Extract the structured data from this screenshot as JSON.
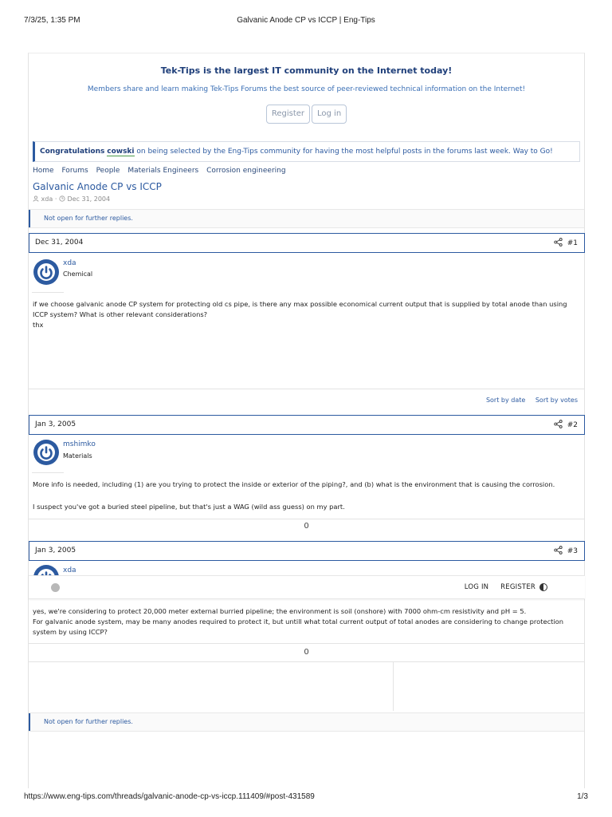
{
  "print": {
    "datetime": "7/3/25, 1:35 PM",
    "doc_title": "Galvanic Anode CP vs ICCP | Eng-Tips",
    "url": "https://www.eng-tips.com/threads/galvanic-anode-cp-vs-iccp.111409/#post-431589",
    "page_num": "1/3"
  },
  "notice": {
    "title": "Tek-Tips is the largest IT community on the Internet today!",
    "subtitle": "Members share and learn making Tek-Tips Forums the best source of peer-reviewed technical information on the Internet!",
    "register_label": "Register",
    "login_label": "Log in"
  },
  "congrats": {
    "lead": "Congratulations",
    "user": "cowski",
    "rest": "on being selected by the Eng-Tips community for having the most helpful posts in the forums last week. Way to Go!"
  },
  "breadcrumb": [
    "Home",
    "Forums",
    "People",
    "Materials Engineers",
    "Corrosion engineering"
  ],
  "thread": {
    "title": "Galvanic Anode CP vs ICCP",
    "author": "xda",
    "sep": "·",
    "date": "Dec 31, 2004",
    "locked_text": "Not open for further replies."
  },
  "posts": [
    {
      "date": "Dec 31, 2004",
      "number": "#1",
      "author": "xda",
      "role": "Chemical",
      "lines": [
        "if we choose galvanic anode CP system for protecting old cs pipe, is there any max possible economical current output that is supplied by total anode than using",
        "ICCP system? What is other relevant considerations?",
        "thx"
      ]
    },
    {
      "date": "Jan 3, 2005",
      "number": "#2",
      "author": "mshimko",
      "role": "Materials",
      "lines": [
        "More info is needed, including (1) are you trying to protect the inside or exterior of the piping?, and (b) what is the environment that is causing the corrosion.",
        "I suspect you've got a buried steel pipeline, but that's just a WAG (wild ass guess) on my part."
      ],
      "reactions": "0"
    },
    {
      "date": "Jan 3, 2005",
      "number": "#3",
      "author": "xda",
      "lines": [
        "yes, we're considering to protect 20,000 meter external burried pipeline; the environment is soil (onshore) with 7000 ohm-cm resistivity and pH = 5.",
        "For galvanic anode system, may be many anodes required to protect it, but untill what total current output of total anodes are considering to change protection",
        "system by using ICCP?"
      ],
      "reactions": "0"
    }
  ],
  "sort": {
    "by_date": "Sort by date",
    "by_votes": "Sort by votes"
  },
  "site_nav": {
    "login": "LOG IN",
    "register": "REGISTER"
  },
  "colors": {
    "accent": "#2c5aa0",
    "title_navy": "#1f3f7a"
  },
  "icons": [
    "user-icon",
    "clock-icon",
    "share-icon",
    "avatar-power-icon",
    "theme-toggle-icon"
  ]
}
